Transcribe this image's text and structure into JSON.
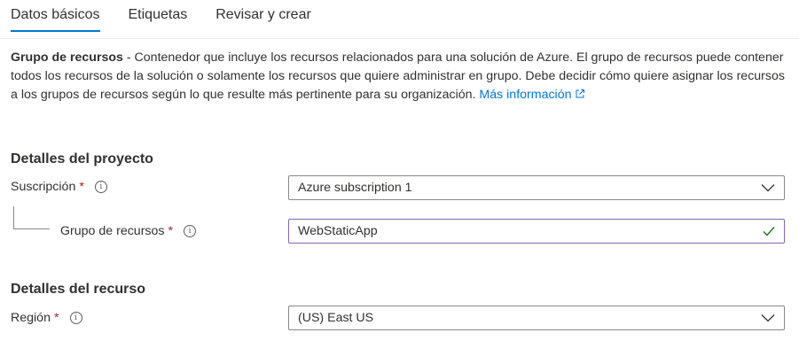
{
  "tabs": [
    {
      "label": "Datos básicos",
      "active": true
    },
    {
      "label": "Etiquetas",
      "active": false
    },
    {
      "label": "Revisar y crear",
      "active": false
    }
  ],
  "description": {
    "bold": "Grupo de recursos",
    "text": " - Contenedor que incluye los recursos relacionados para una solución de Azure. El grupo de recursos puede contener todos los recursos de la solución o solamente los recursos que quiere administrar en grupo. Debe decidir cómo quiere asignar los recursos a los grupos de recursos según lo que resulte más pertinente para su organización. ",
    "link": "Más información"
  },
  "project": {
    "title": "Detalles del proyecto",
    "subscription": {
      "label": "Suscripción",
      "required_mark": "*",
      "value": "Azure subscription 1",
      "icon": "chevron-down-icon"
    },
    "resource_group": {
      "label": "Grupo de recursos",
      "required_mark": "*",
      "value": "WebStaticApp",
      "status_icon": "checkmark-icon"
    }
  },
  "resource": {
    "title": "Detalles del recurso",
    "region": {
      "label": "Región",
      "required_mark": "*",
      "value": "(US) East US",
      "icon": "chevron-down-icon"
    }
  },
  "info_glyph": "i",
  "colors": {
    "accent": "#0078d4",
    "required": "#a4262c",
    "focus_border": "#8764b8",
    "valid": "#107c10"
  }
}
